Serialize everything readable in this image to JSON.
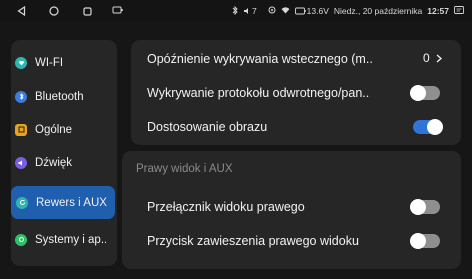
{
  "statusbar": {
    "icons": [
      "back-icon",
      "home-icon",
      "recents-icon",
      "screen-icon",
      "bluetooth-icon",
      "volume-icon",
      "location-icon",
      "wifi-icon",
      "battery-icon",
      "notification-icon"
    ],
    "volume_text": "7",
    "voltage_text": "13.6V",
    "date_text": "Niedz., 20 października",
    "time_text": "12:57"
  },
  "sidebar": {
    "items": [
      {
        "label": "WI-FI",
        "icon": "wifi-icon",
        "color": "#2fb5b0",
        "active": false
      },
      {
        "label": "Bluetooth",
        "icon": "bluetooth-icon",
        "color": "#3d7be0",
        "active": false
      },
      {
        "label": "Ogólne",
        "icon": "general-icon",
        "color": "#e8a321",
        "active": false
      },
      {
        "label": "Dźwięk",
        "icon": "sound-icon",
        "color": "#7a5fe0",
        "active": false
      },
      {
        "label": "Rewers i AUX",
        "icon": "reverse-icon",
        "color": "#2fb5b0",
        "active": true
      },
      {
        "label": "Systemy i ap..",
        "icon": "systems-icon",
        "color": "#2fbf6a",
        "active": false
      }
    ]
  },
  "settings": {
    "reverse_detect_delay": {
      "label": "Opóźnienie wykrywania wstecznego (m..",
      "value": "0"
    },
    "reverse_protocol_detect": {
      "label": "Wykrywanie protokołu odwrotnego/pan..",
      "on": false
    },
    "image_adjust": {
      "label": "Dostosowanie obrazu",
      "on": true
    },
    "section_title": "Prawy widok i AUX",
    "right_view_switch": {
      "label": "Przełącznik widoku prawego",
      "on": false
    },
    "right_view_suspend": {
      "label": "Przycisk zawieszenia prawego widoku",
      "on": false
    }
  },
  "colors": {
    "accent": "#2f74d6",
    "active_bg": "#1f5fae",
    "panel_bg": "#262626",
    "page_bg": "#161616"
  }
}
